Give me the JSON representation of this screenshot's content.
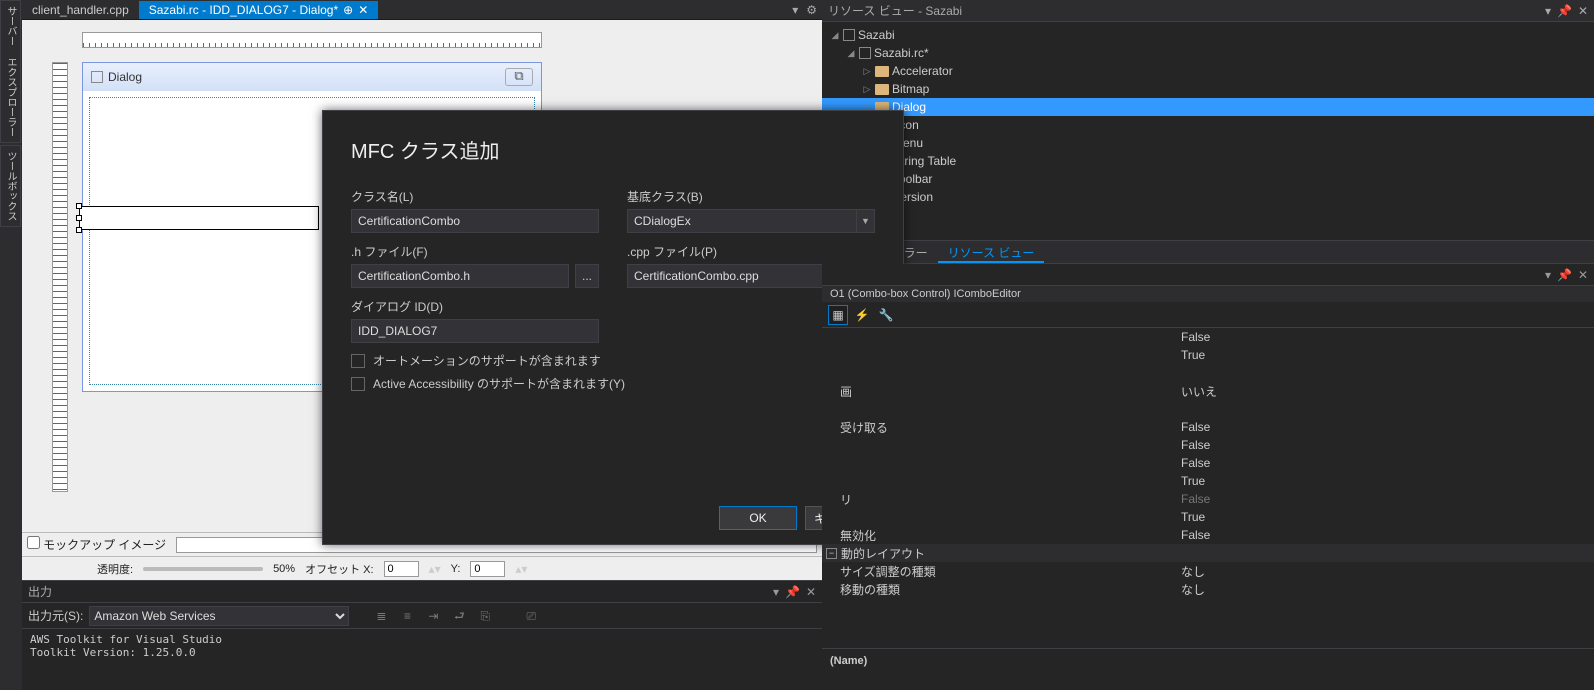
{
  "vertical_tabs": [
    "サーバー エクスプローラー",
    "ツールボックス"
  ],
  "tabs": {
    "t0": "client_handler.cpp",
    "t1": "Sazabi.rc - IDD_DIALOG7 - Dialog*"
  },
  "dialog_preview": {
    "title": "Dialog"
  },
  "editor_bottom": {
    "mockup": "モックアップ イメージ",
    "opacity_label": "透明度:",
    "opacity_value": "50%",
    "offx_label": "オフセット X:",
    "offx": "0",
    "offy_label": "Y:",
    "offy": "0"
  },
  "modal": {
    "title": "MFC クラス追加",
    "class_label": "クラス名(L)",
    "class_value": "CertificationCombo",
    "base_label": "基底クラス(B)",
    "base_value": "CDialogEx",
    "h_label": ".h ファイル(F)",
    "h_value": "CertificationCombo.h",
    "cpp_label": ".cpp ファイル(P)",
    "cpp_value": "CertificationCombo.cpp",
    "dlgid_label": "ダイアログ ID(D)",
    "dlgid_value": "IDD_DIALOG7",
    "chk_automation": "オートメーションのサポートが含まれます",
    "chk_accessibility": "Active Accessibility のサポートが含まれます(Y)",
    "ok": "OK",
    "cancel": "キャンセル",
    "ellipsis": "..."
  },
  "output": {
    "title": "出力",
    "source_label": "出力元(S):",
    "source_value": "Amazon Web Services",
    "lines": "AWS Toolkit for Visual Studio\nToolkit Version: 1.25.0.0"
  },
  "resource_view": {
    "title": "リソース ビュー - Sazabi",
    "root": "Sazabi",
    "rc": "Sazabi.rc*",
    "items": [
      "Accelerator",
      "Bitmap",
      "Dialog",
      "Icon",
      "Menu",
      "String Table",
      "Toolbar",
      "Version"
    ],
    "tabs": {
      "explorer": "エクスプローラー",
      "resource": "リソース ビュー"
    }
  },
  "properties": {
    "subject": "O1 (Combo-box Control)  IComboEditor",
    "rows": [
      {
        "name": "",
        "val": "False"
      },
      {
        "name": "",
        "val": "True"
      },
      {
        "name": "画",
        "val": "いいえ"
      },
      {
        "name": "受け取る",
        "val": "False"
      },
      {
        "name": "",
        "val": "False"
      },
      {
        "name": "",
        "val": "False"
      },
      {
        "name": "",
        "val": "True"
      },
      {
        "name": "リ",
        "val": "False",
        "dim": true
      },
      {
        "name": "",
        "val": "True"
      },
      {
        "name": "無効化",
        "val": "False"
      }
    ],
    "cat": "動的レイアウト",
    "after": [
      {
        "name": "サイズ調整の種類",
        "val": "なし"
      },
      {
        "name": "移動の種類",
        "val": "なし"
      }
    ],
    "desc": "(Name)"
  }
}
